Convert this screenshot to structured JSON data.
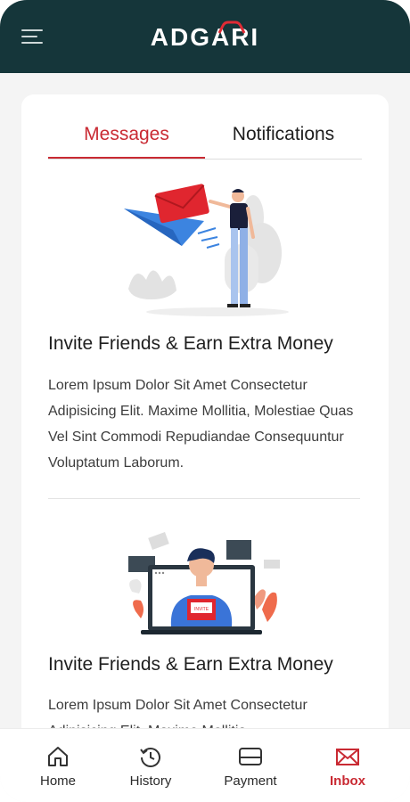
{
  "header": {
    "logo_text": "ADGARI",
    "menu_icon": "hamburger-menu-icon"
  },
  "tabs": [
    {
      "label": "Messages",
      "active": true
    },
    {
      "label": "Notifications",
      "active": false
    }
  ],
  "messages": [
    {
      "title": "Invite Friends & Earn Extra Money",
      "body": "Lorem Ipsum Dolor Sit Amet Consectetur Adipisicing Elit. Maxime Mollitia, Molestiae Quas Vel Sint Commodi Repudiandae Consequuntur Voluptatum Laborum."
    },
    {
      "title": "Invite Friends & Earn Extra Money",
      "body": "Lorem Ipsum Dolor Sit Amet Consectetur Adipisicing Elit. Maxime Mollitia,"
    }
  ],
  "illustration_text": {
    "letter": "INVITE"
  },
  "bottom_nav": [
    {
      "label": "Home",
      "icon": "home-icon",
      "active": false
    },
    {
      "label": "History",
      "icon": "history-icon",
      "active": false
    },
    {
      "label": "Payment",
      "icon": "card-icon",
      "active": false
    },
    {
      "label": "Inbox",
      "icon": "mail-icon",
      "active": true
    }
  ],
  "colors": {
    "header_bg": "#15363a",
    "accent": "#c92a33",
    "text": "#1f1f1f"
  }
}
